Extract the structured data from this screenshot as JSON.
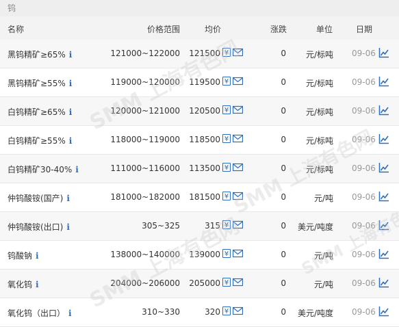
{
  "panel_title": "钨",
  "header": {
    "name": "名称",
    "range": "价格范围",
    "avg": "均价",
    "change": "涨跌",
    "unit": "单位",
    "date": "日期"
  },
  "watermark_text": "SMM 上海有色网",
  "info_glyph": "i",
  "yen_glyph": "¥",
  "rows": [
    {
      "name": "黑钨精矿≥65%",
      "range": "121000~122000",
      "avg": "121500",
      "change": "0",
      "unit": "元/标吨",
      "date": "09-06"
    },
    {
      "name": "黑钨精矿≥55%",
      "range": "119000~120000",
      "avg": "119500",
      "change": "0",
      "unit": "元/标吨",
      "date": "09-06"
    },
    {
      "name": "白钨精矿≥65%",
      "range": "120000~121000",
      "avg": "120500",
      "change": "0",
      "unit": "元/标吨",
      "date": "09-06"
    },
    {
      "name": "白钨精矿≥55%",
      "range": "118000~119000",
      "avg": "118500",
      "change": "0",
      "unit": "元/标吨",
      "date": "09-06"
    },
    {
      "name": "白钨精矿30-40%",
      "range": "111000~116000",
      "avg": "113500",
      "change": "0",
      "unit": "元/标吨",
      "date": "09-06"
    },
    {
      "name": "仲钨酸铵(国产)",
      "range": "181000~182000",
      "avg": "181500",
      "change": "0",
      "unit": "元/吨",
      "date": "09-06"
    },
    {
      "name": "仲钨酸铵(出口)",
      "range": "305~325",
      "avg": "315",
      "change": "0",
      "unit": "美元/吨度",
      "date": "09-06"
    },
    {
      "name": "钨酸钠",
      "range": "138000~140000",
      "avg": "139000",
      "change": "0",
      "unit": "元/吨",
      "date": "09-06"
    },
    {
      "name": "氧化钨",
      "range": "204000~206000",
      "avg": "205000",
      "change": "0",
      "unit": "元/吨",
      "date": "09-06"
    },
    {
      "name": "氧化钨（出口）",
      "range": "310~330",
      "avg": "320",
      "change": "0",
      "unit": "美元/吨度",
      "date": "09-06"
    }
  ]
}
